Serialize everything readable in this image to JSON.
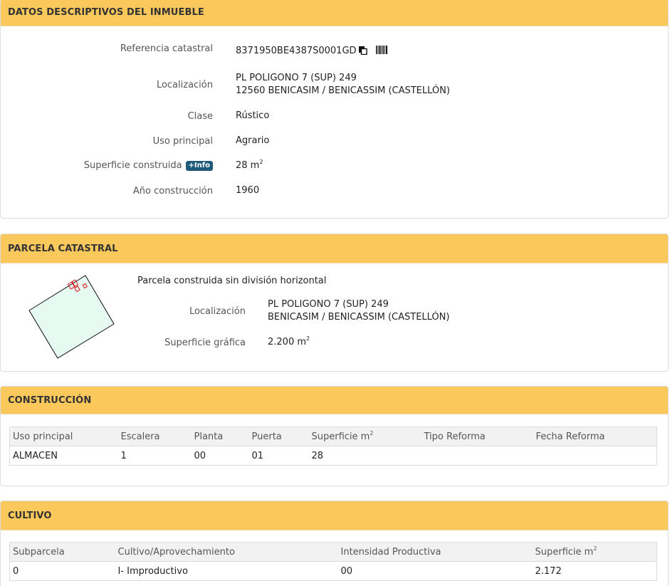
{
  "datos": {
    "title": "DATOS DESCRIPTIVOS DEL INMUEBLE",
    "ref_label": "Referencia catastral",
    "ref_value": "8371950BE4387S0001GD",
    "loc_label": "Localización",
    "loc_line1": "PL POLIGONO 7 (SUP) 249",
    "loc_line2": "12560 BENICASIM / BENICASSIM (CASTELLÓN)",
    "clase_label": "Clase",
    "clase_value": "Rústico",
    "uso_label": "Uso principal",
    "uso_value": "Agrario",
    "sup_label": "Superficie construida",
    "info_badge": "+Info",
    "sup_value": "28 m",
    "sup_unit_exp": "2",
    "anio_label": "Año construcción",
    "anio_value": "1960"
  },
  "parcela": {
    "title": "PARCELA CATASTRAL",
    "subtitle": "Parcela construida sin división horizontal",
    "loc_label": "Localización",
    "loc_line1": "PL POLIGONO 7 (SUP) 249",
    "loc_line2": "BENICASIM / BENICASSIM (CASTELLÓN)",
    "sup_label": "Superficie gráfica",
    "sup_value": "2.200 m",
    "sup_unit_exp": "2"
  },
  "construccion": {
    "title": "CONSTRUCCIÓN",
    "headers": [
      "Uso principal",
      "Escalera",
      "Planta",
      "Puerta",
      "Superficie m",
      "Tipo Reforma",
      "Fecha Reforma"
    ],
    "sup_header_exp": "2",
    "rows": [
      [
        "ALMACEN",
        "1",
        "00",
        "01",
        "28",
        "",
        ""
      ]
    ]
  },
  "cultivo": {
    "title": "CULTIVO",
    "headers": [
      "Subparcela",
      "Cultivo/Aprovechamiento",
      "Intensidad Productiva",
      "Superficie m"
    ],
    "sup_header_exp": "2",
    "rows": [
      [
        "0",
        "I- Improductivo",
        "00",
        "2.172"
      ]
    ]
  },
  "icons": [
    "copy-icon",
    "barcode-icon",
    "parcel-map-icon"
  ],
  "colors": {
    "header_bg": "#fbc85b",
    "badge_bg": "#1e5b7a",
    "parcel_fill": "#e6faf2",
    "building_stroke": "#d9141b"
  }
}
